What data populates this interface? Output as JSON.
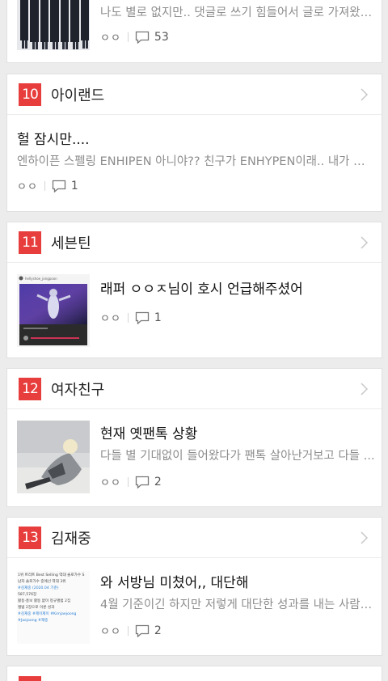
{
  "cards": [
    {
      "rank": "",
      "group": "",
      "post": {
        "title": "",
        "excerpt": "나도 별로 없지만.. 댓글로 쓰기 힘들어서 글로 가져왔어 ...",
        "author": "ㅇㅇ",
        "comments": "53",
        "thumbnail": "group-photo"
      }
    },
    {
      "rank": "10",
      "group": "아이랜드",
      "post": {
        "title": "헐 잠시만....",
        "excerpt": "엔하이픈 스펠링 ENHIPEN 아니야?? 친구가 ENHYPEN이래.. 내가 잘못 ...",
        "author": "ㅇㅇ",
        "comments": "1",
        "thumbnail": ""
      }
    },
    {
      "rank": "11",
      "group": "세븐틴",
      "post": {
        "title": "래퍼 ㅇㅇㅈ님이 호시 언급해주셨어",
        "excerpt": "",
        "author": "ㅇㅇ",
        "comments": "1",
        "thumbnail": "instagram-post"
      }
    },
    {
      "rank": "12",
      "group": "여자친구",
      "post": {
        "title": "현재 옛팬톡 상황",
        "excerpt": "다들 별 기대없이 들어왔다가 팬톡 살아난거보고 다들 ...",
        "author": "ㅇㅇ",
        "comments": "2",
        "thumbnail": "person-photo"
      }
    },
    {
      "rank": "13",
      "group": "김재중",
      "post": {
        "title": "와 서방님 미쳤어,, 대단해",
        "excerpt": "4월 기준이긴 하지만 저렇게 대단한 성과를 내는 사람이 ...",
        "author": "ㅇㅇ",
        "comments": "2",
        "thumbnail": "text-image"
      }
    }
  ],
  "thumbnail_text": {
    "card13": [
      "1위 트리트 Best Selling 역대 솔로가수 S",
      "남자 솔로가수 중에선 역대 3위",
      "#김재중 (2020.04 기준)",
      "587,576장",
      "활동·홍보 활동 없이 정규앨범 2집",
      "앨범 2장으로 이룬 성과",
      "#김재중 #제이제이 #Kimjaejoong",
      "#Jaejoong #재중"
    ],
    "card11": "hellyshoe_jongpoon"
  },
  "colors": {
    "rank_bg": "#e73d3d",
    "background": "#ececec",
    "card": "#ffffff"
  }
}
